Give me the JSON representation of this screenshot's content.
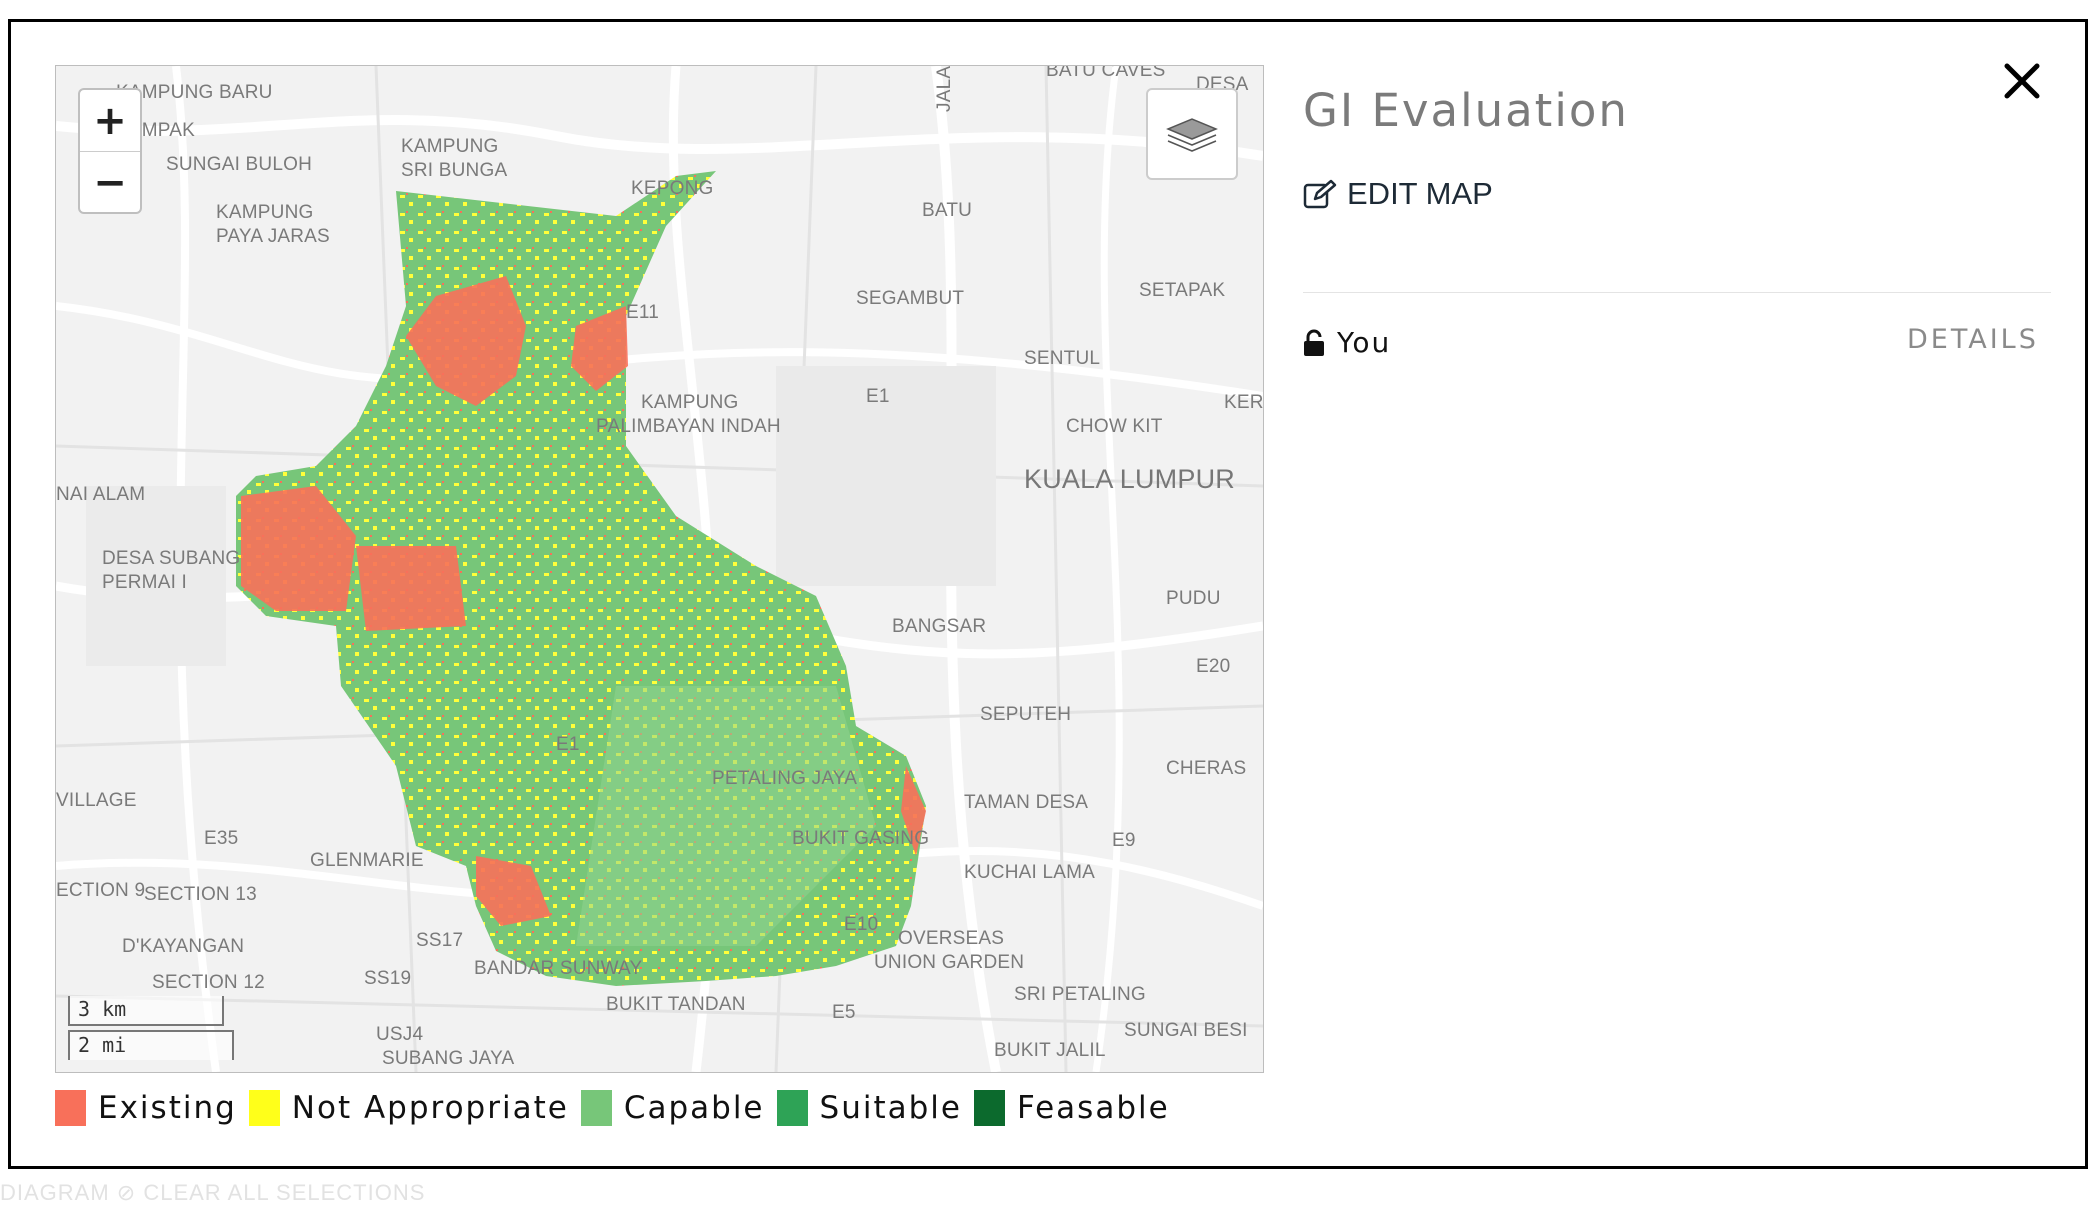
{
  "panel": {
    "title": "GI Evaluation",
    "edit_label": "EDIT MAP",
    "owner_label": "You",
    "details_label": "DETAILS"
  },
  "map": {
    "zoom_in_label": "+",
    "zoom_out_label": "−",
    "scale_km": "3 km",
    "scale_mi": "2 mi",
    "place_labels": [
      "KAMPUNG BARU",
      "SEMPAK",
      "SUNGAI BULOH",
      "KAMPUNG",
      "SRI BUNGA",
      "KAMPUNG",
      "PAYA JARAS",
      "KEPONG",
      "BATU",
      "SEGAMBUT",
      "SETAPAK",
      "SENTUL",
      "KAMPUNG",
      "PALIMBAYAN INDAH",
      "CHOW KIT",
      "KUALA LUMPUR",
      "PUDU",
      "BANGSAR",
      "SEPUTEH",
      "NAI ALAM",
      "DESA SUBANG",
      "PERMAI I",
      "VILLAGE",
      "CHERAS",
      "TAMAN DESA",
      "PETALING JAYA",
      "BUKIT GASING",
      "KUCHAI LAMA",
      "GLENMARIE",
      "SECTION 13",
      "ECTION 9",
      "D'KAYANGAN",
      "SS17",
      "SECTION 12",
      "SS19",
      "BANDAR SUNWAY",
      "OVERSEAS",
      "UNION GARDEN",
      "BUKIT TANDAN",
      "SRI PETALING",
      "SUNGAI BESI",
      "USJ4",
      "SUBANG JAYA",
      "BUKIT JALIL",
      "JALAN IP",
      "BATU CAVES",
      "DESA",
      "KER",
      "E1",
      "E20",
      "E9",
      "E35",
      "E10",
      "E5",
      "E11",
      "E1"
    ]
  },
  "legend": [
    {
      "label": "Existing",
      "color": "#f8705a"
    },
    {
      "label": "Not Appropriate",
      "color": "#ffff1a"
    },
    {
      "label": "Capable",
      "color": "#77c679"
    },
    {
      "label": "Suitable",
      "color": "#2ea356"
    },
    {
      "label": "Feasable",
      "color": "#0c6a2d"
    }
  ],
  "below_text": "DIAGRAM    ⊘ CLEAR ALL SELECTIONS",
  "icons": {
    "close": "close-icon",
    "edit": "edit-icon",
    "lock": "unlock-icon",
    "layers": "layers-icon"
  }
}
